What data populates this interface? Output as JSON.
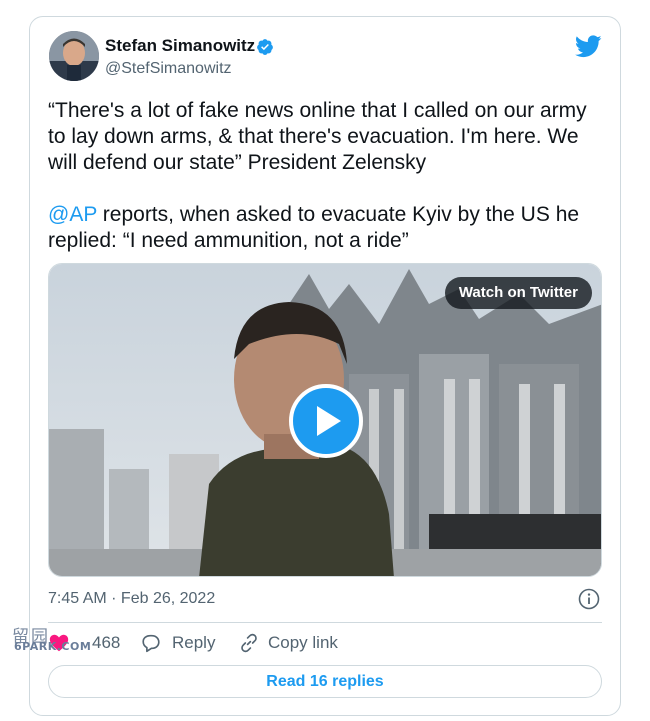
{
  "tweet": {
    "author": {
      "display_name": "Stefan Simanowitz",
      "handle": "@StefSimanowitz",
      "verified": true
    },
    "text_paragraph_1": "“There's a lot of fake news online that I called on our army to lay down arms, & that there's evacuation. I'm here. We will defend our state” President Zelensky",
    "text_paragraph_2_mention": "@AP",
    "text_paragraph_2_rest": " reports, when asked to evacuate Kyiv by the US he replied: “I need ammunition, not a ride”",
    "media": {
      "watch_label": "Watch on Twitter"
    },
    "timestamp": "7:45 AM · Feb 26, 2022",
    "actions": {
      "like_count": "468",
      "reply_label": "Reply",
      "copy_link_label": "Copy link"
    },
    "read_replies_label": "Read 16 replies"
  },
  "watermark": {
    "chars": "留园",
    "site": "6PARK.COM"
  },
  "colors": {
    "accent": "#1d9bf0",
    "text": "#0f1419",
    "secondary": "#536471",
    "border": "#cfd9de"
  },
  "icons": [
    "verified-badge-icon",
    "twitter-bird-icon",
    "play-icon",
    "info-icon",
    "heart-icon",
    "reply-bubble-icon",
    "link-icon"
  ]
}
